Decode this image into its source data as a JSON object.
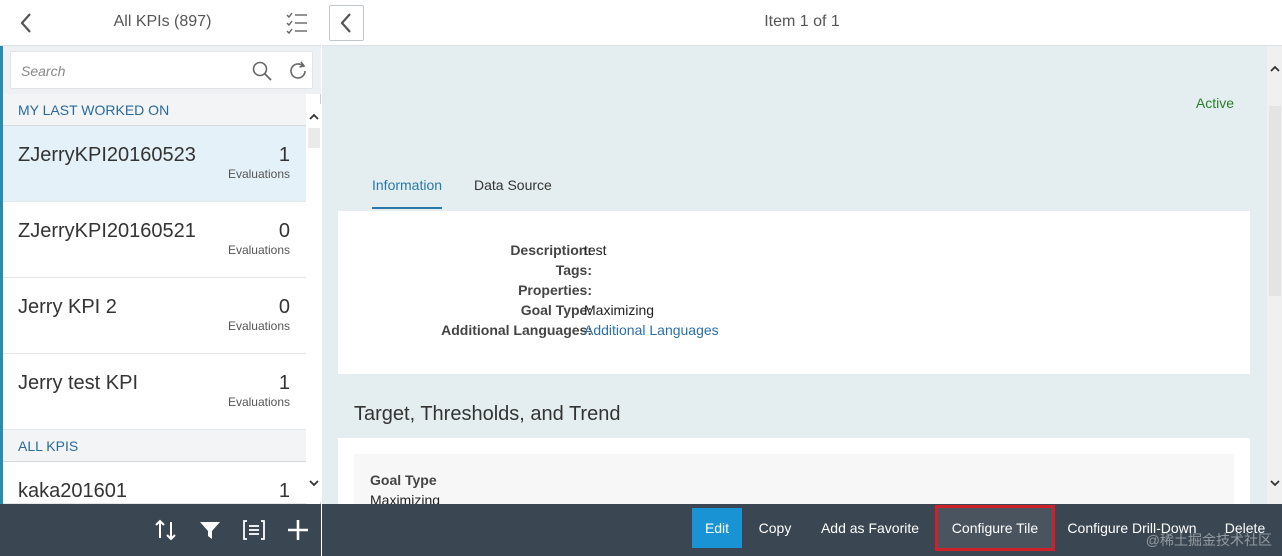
{
  "master": {
    "title": "All KPIs (897)",
    "search_placeholder": "Search",
    "groups": {
      "recent": "MY LAST WORKED ON",
      "all": "ALL KPIS"
    },
    "items": [
      {
        "title": "ZJerryKPI20160523",
        "number": "1",
        "unit": "Evaluations",
        "selected": true
      },
      {
        "title": "ZJerryKPI20160521",
        "number": "0",
        "unit": "Evaluations",
        "selected": false
      },
      {
        "title": "Jerry KPI 2",
        "number": "0",
        "unit": "Evaluations",
        "selected": false
      },
      {
        "title": "Jerry test KPI",
        "number": "1",
        "unit": "Evaluations",
        "selected": false
      },
      {
        "title": "kaka201601",
        "number": "1",
        "unit": "",
        "selected": false
      }
    ],
    "footer_icons": [
      "sort-icon",
      "filter-icon",
      "group-icon",
      "add-icon"
    ]
  },
  "detail": {
    "title": "Item 1 of 1",
    "status": "Active",
    "status_color": "#2b7d2b",
    "tabs": [
      {
        "label": "Information",
        "active": true
      },
      {
        "label": "Data Source",
        "active": false
      }
    ],
    "info": {
      "description_label": "Description:",
      "description_value": "test",
      "tags_label": "Tags:",
      "tags_value": "",
      "properties_label": "Properties:",
      "properties_value": "",
      "goal_type_label": "Goal Type:",
      "goal_type_value": "Maximizing",
      "languages_label": "Additional Languages:",
      "languages_value": "Additional Languages"
    },
    "section": {
      "title": "Target, Thresholds, and Trend",
      "goal_type_label": "Goal Type",
      "goal_type_value": "Maximizing"
    },
    "footer": {
      "edit": "Edit",
      "copy": "Copy",
      "favorite": "Add as Favorite",
      "configure_tile": "Configure Tile",
      "configure_drilldown": "Configure Drill-Down",
      "delete": "Delete"
    },
    "accent_color": "#1a93d4"
  },
  "watermark": "@稀土掘金技术社区"
}
